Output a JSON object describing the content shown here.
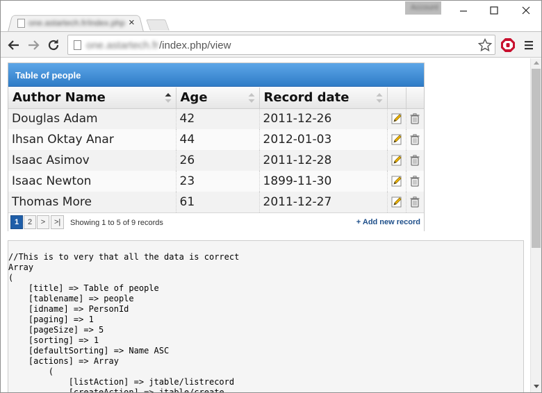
{
  "browser": {
    "tab": {
      "title": "one.astartech.fr/index.php",
      "close_glyph": "×"
    },
    "profile_label": "Account",
    "url": {
      "host": "one.astartech.fr",
      "path": "/index.php/view"
    }
  },
  "jtable": {
    "title": "Table of people",
    "columns": [
      "Author Name",
      "Age",
      "Record date"
    ],
    "rows": [
      {
        "name": "Douglas Adam",
        "age": "42",
        "date": "2011-12-26"
      },
      {
        "name": "Ihsan Oktay Anar",
        "age": "44",
        "date": "2012-01-03"
      },
      {
        "name": "Isaac Asimov",
        "age": "26",
        "date": "2011-12-28"
      },
      {
        "name": "Isaac Newton",
        "age": "23",
        "date": "1899-11-30"
      },
      {
        "name": "Thomas More",
        "age": "61",
        "date": "2011-12-27"
      }
    ],
    "pager": {
      "page1": "1",
      "page2": "2",
      "next": ">",
      "last": ">|"
    },
    "paging_info": "Showing 1 to 5 of 9 records",
    "add_record": "+ Add new record"
  },
  "debug_text": "//This is to very that all the data is correct\nArray\n(\n    [title] => Table of people\n    [tablename] => people\n    [idname] => PersonId\n    [paging] => 1\n    [pageSize] => 5\n    [sorting] => 1\n    [defaultSorting] => Name ASC\n    [actions] => Array\n        (\n            [listAction] => jtable/listrecord\n            [createAction] => jtable/create",
  "icons": {
    "back": "back-arrow-icon",
    "forward": "forward-arrow-icon",
    "reload": "reload-icon",
    "star": "bookmark-star-icon",
    "extension": "stop-hand-icon",
    "menu": "hamburger-menu-icon",
    "edit": "edit-pencil-icon",
    "delete": "trash-icon"
  },
  "colors": {
    "header_blue": "#2f7cc7",
    "active_page": "#1f5ea8",
    "link": "#1e4f8a",
    "extension_red": "#d0021b"
  }
}
